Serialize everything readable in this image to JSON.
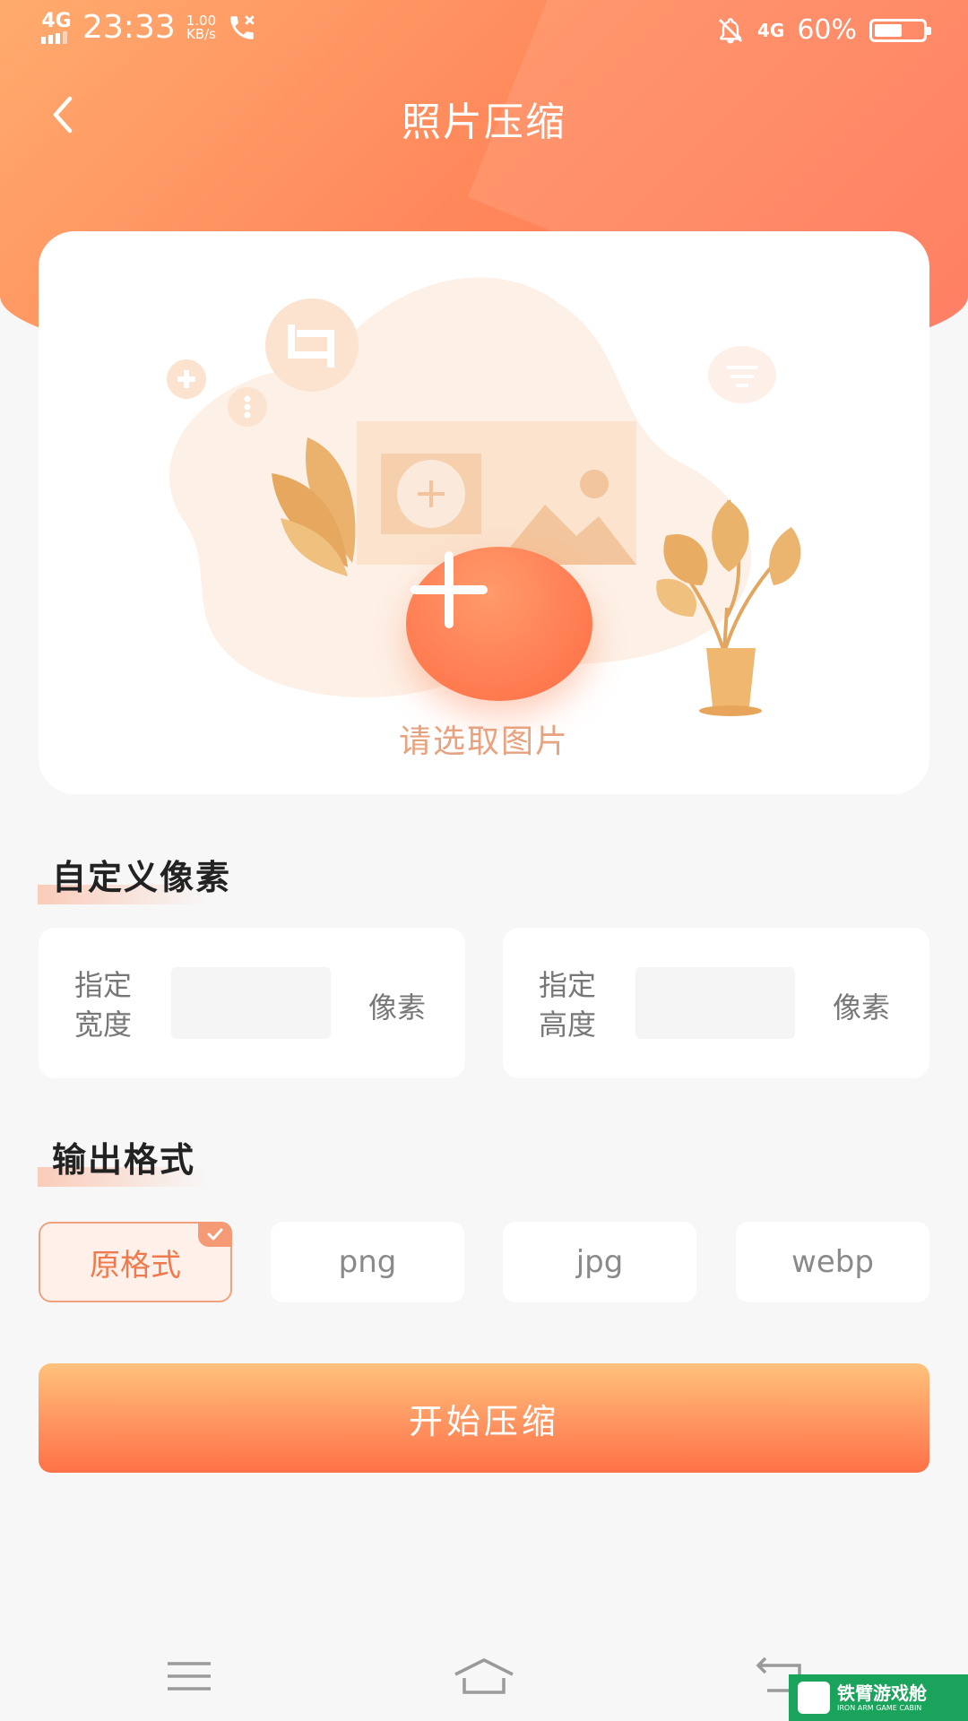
{
  "status_bar": {
    "network": "4G",
    "time": "23:33",
    "speed_value": "1.00",
    "speed_unit": "KB/s",
    "network_right": "4G",
    "battery_text": "60%",
    "battery_level": 0.6
  },
  "header": {
    "title": "照片压缩",
    "back_icon": "chevron-left-icon"
  },
  "picker": {
    "hint": "请选取图片",
    "add_icon": "plus-icon"
  },
  "custom_pixels": {
    "title": "自定义像素",
    "width": {
      "label": "指定宽度",
      "value": "",
      "unit": "像素"
    },
    "height": {
      "label": "指定高度",
      "value": "",
      "unit": "像素"
    }
  },
  "output_format": {
    "title": "输出格式",
    "options": [
      {
        "label": "原格式",
        "selected": true
      },
      {
        "label": "png",
        "selected": false
      },
      {
        "label": "jpg",
        "selected": false
      },
      {
        "label": "webp",
        "selected": false
      }
    ]
  },
  "start_button": {
    "label": "开始压缩"
  },
  "navbar": {
    "icons": [
      "menu-icon",
      "home-icon",
      "back-icon"
    ]
  },
  "watermark": {
    "main": "铁臂游戏舱",
    "sub": "IRON ARM GAME CABIN"
  },
  "colors": {
    "accent": "#ff7a4f",
    "accent_light": "#ffab6e",
    "selected_text": "#f07a4d"
  }
}
